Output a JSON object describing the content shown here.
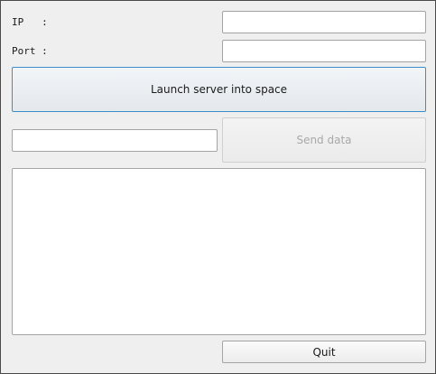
{
  "connection": {
    "ip_label": "IP   :",
    "ip_value": "",
    "port_label": "Port :",
    "port_value": ""
  },
  "actions": {
    "launch_label": "Launch server into space",
    "send_label": "Send data",
    "send_enabled": false,
    "quit_label": "Quit"
  },
  "message": {
    "value": ""
  },
  "log": {
    "content": ""
  }
}
